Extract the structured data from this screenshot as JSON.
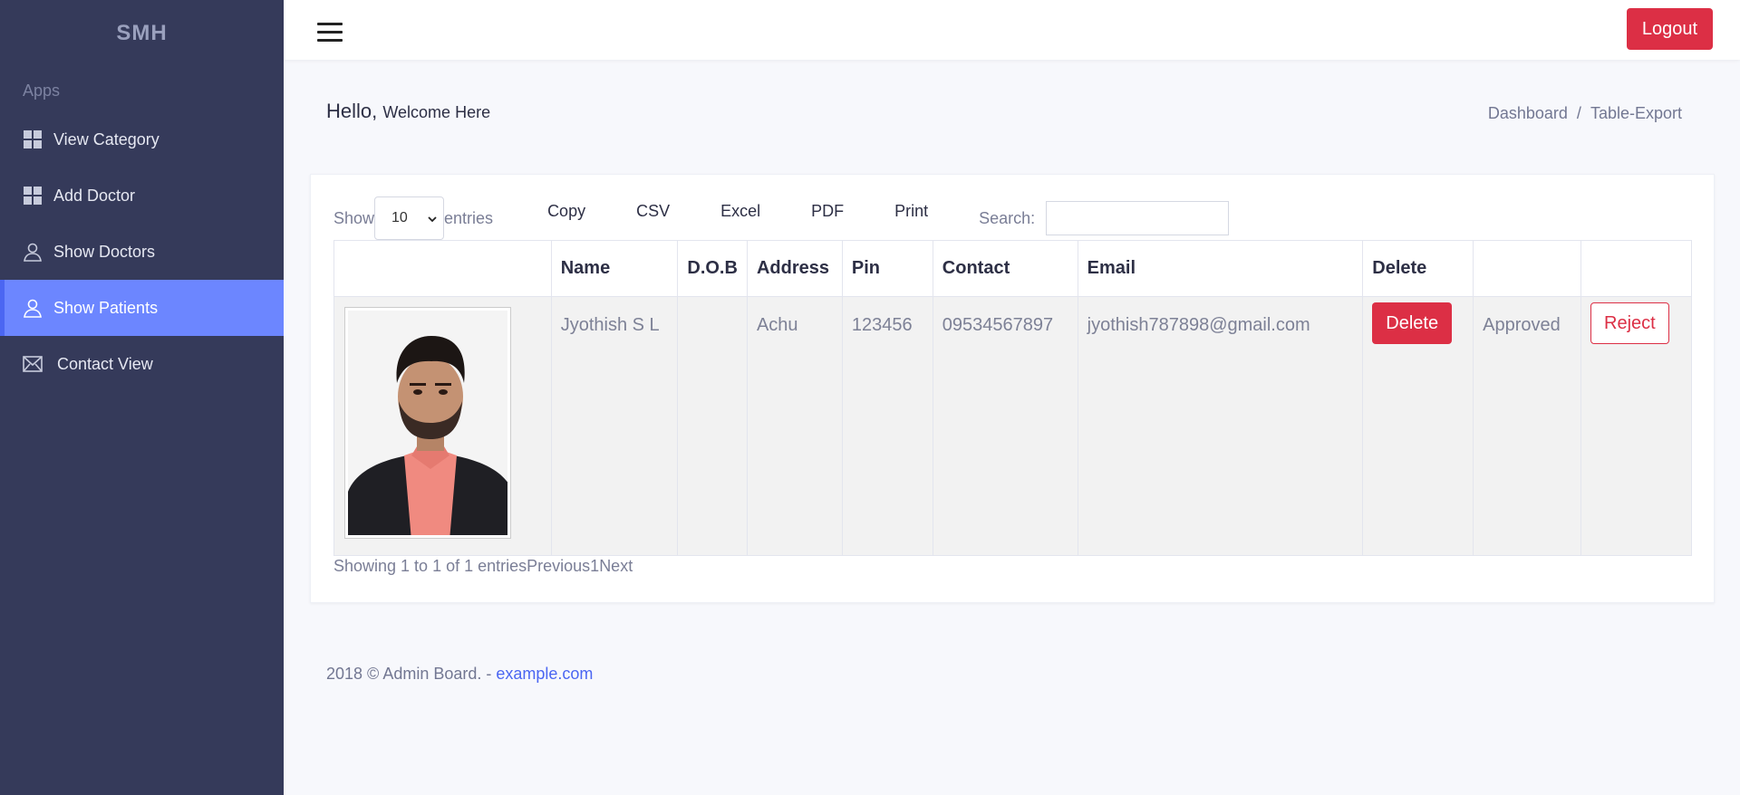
{
  "sidebar": {
    "brand": "SMH",
    "section": "Apps",
    "items": [
      {
        "label": "View Category",
        "icon": "grid-icon"
      },
      {
        "label": "Add Doctor",
        "icon": "grid-icon"
      },
      {
        "label": "Show Doctors",
        "icon": "user-icon"
      },
      {
        "label": "Show Patients",
        "icon": "user-icon",
        "active": true
      },
      {
        "label": "Contact View",
        "icon": "mail-icon"
      }
    ]
  },
  "header": {
    "logout_label": "Logout"
  },
  "page": {
    "hello": "Hello,",
    "welcome": "Welcome Here",
    "breadcrumb": [
      "Dashboard",
      "Table-Export"
    ],
    "breadcrumb_sep": "/"
  },
  "table_controls": {
    "show_label": "Show",
    "entries_value": "10",
    "entries_label": "entries",
    "export_buttons": [
      "Copy",
      "CSV",
      "Excel",
      "PDF",
      "Print"
    ],
    "search_label": "Search:",
    "search_value": ""
  },
  "table": {
    "columns": [
      "",
      "Name",
      "D.O.B",
      "Address",
      "Pin",
      "Contact",
      "Email",
      "Delete",
      "",
      ""
    ],
    "rows": [
      {
        "name": "Jyothish S L",
        "dob": "",
        "address": "Achu",
        "pin": "123456",
        "contact": "09534567897",
        "email": "jyothish787898@gmail.com",
        "delete_label": "Delete",
        "status": "Approved",
        "reject_label": "Reject"
      }
    ]
  },
  "pagination": {
    "info": "Showing 1 to 1 of 1 entries",
    "previous": "Previous",
    "page": "1",
    "next": "Next"
  },
  "footer": {
    "text": "2018 © Admin Board. - ",
    "link": "example.com"
  },
  "colors": {
    "sidebar_bg": "#353a5a",
    "active_item": "#6c86ff",
    "danger": "#dc2f45",
    "link": "#4b66f2"
  }
}
